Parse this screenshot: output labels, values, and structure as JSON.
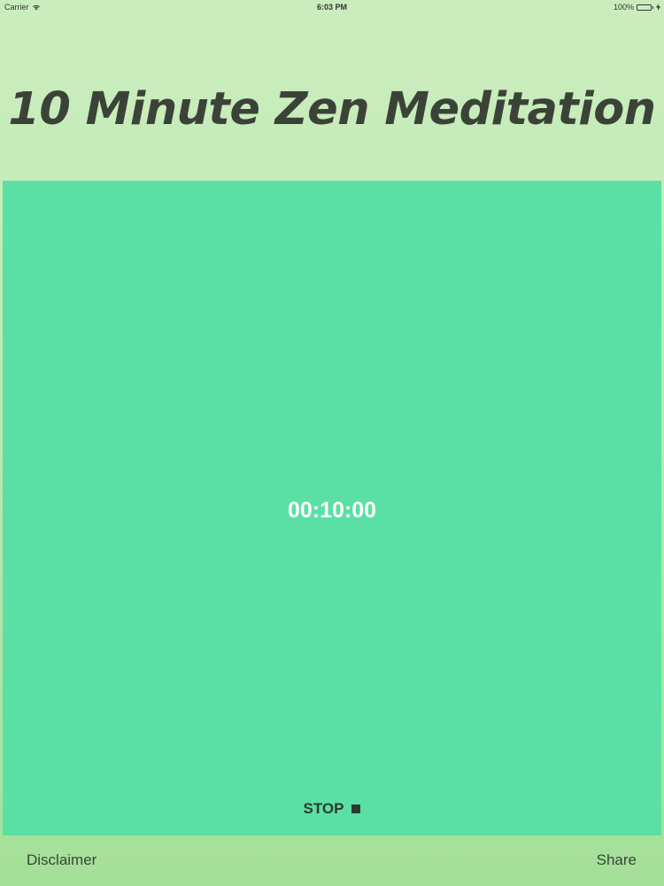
{
  "status_bar": {
    "carrier": "Carrier",
    "time": "6:03 PM",
    "battery": "100%",
    "battery_level": 1.0,
    "battery_color": "#4cd964"
  },
  "title": "10 Minute Zen Meditation",
  "timer": {
    "display": "00:10:00",
    "stop_label": "STOP"
  },
  "bottom_bar": {
    "disclaimer": "Disclaimer",
    "share": "Share"
  },
  "colors": {
    "panel": "#5ae0a5",
    "background_top": "#cbedbd",
    "background_bottom": "#a4e098",
    "text_dark": "#3b4338",
    "timer_text": "#ffffff"
  },
  "icons": [
    "wifi-icon",
    "battery-icon",
    "charging-icon",
    "stop-icon"
  ]
}
